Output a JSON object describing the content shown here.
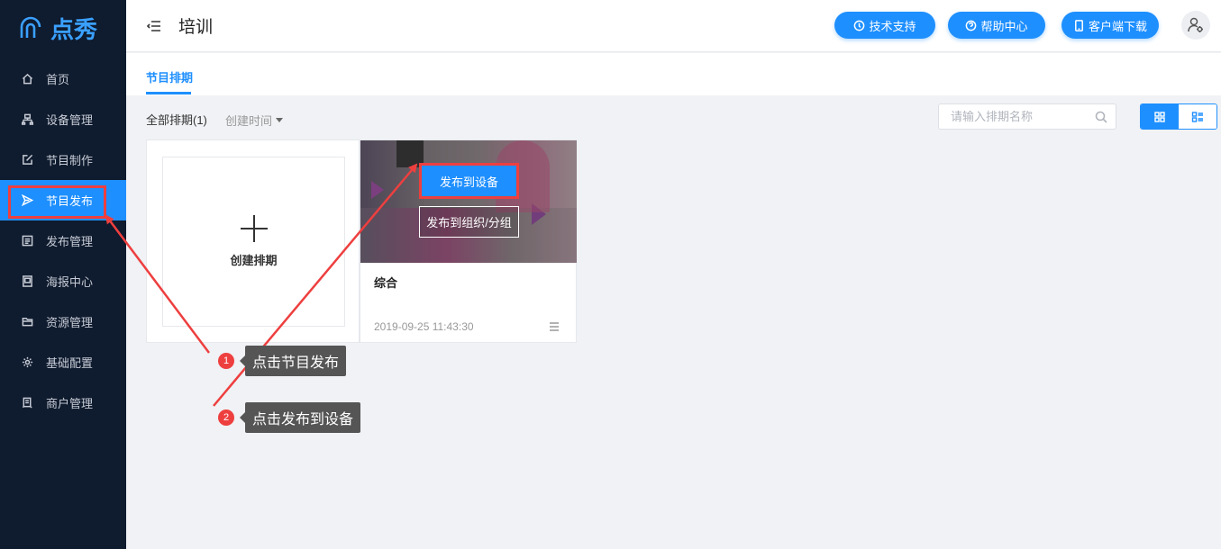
{
  "app": {
    "logo_text": "点秀",
    "brand_color": "#1e8fff"
  },
  "sidebar": {
    "items": [
      {
        "label": "首页",
        "icon": "home-icon"
      },
      {
        "label": "设备管理",
        "icon": "device-icon"
      },
      {
        "label": "节目制作",
        "icon": "edit-icon"
      },
      {
        "label": "节目发布",
        "icon": "send-icon",
        "active": true
      },
      {
        "label": "发布管理",
        "icon": "list-icon"
      },
      {
        "label": "海报中心",
        "icon": "poster-icon"
      },
      {
        "label": "资源管理",
        "icon": "folder-icon"
      },
      {
        "label": "基础配置",
        "icon": "gear-icon"
      },
      {
        "label": "商户管理",
        "icon": "merchant-icon"
      }
    ]
  },
  "header": {
    "title": "培训",
    "buttons": {
      "support": "技术支持",
      "help": "帮助中心",
      "download": "客户端下载"
    }
  },
  "tabs": {
    "active": "节目排期"
  },
  "filter": {
    "all_label": "全部排期(1)",
    "sort_label": "创建时间"
  },
  "search": {
    "placeholder": "请输入排期名称",
    "value": ""
  },
  "cards": {
    "create_label": "创建排期",
    "program": {
      "name": "综合",
      "date": "2019-09-25 11:43:30",
      "publish_device": "发布到设备",
      "publish_group": "发布到组织/分组"
    }
  },
  "annotations": {
    "step1_num": "1",
    "step1_text": "点击节目发布",
    "step2_num": "2",
    "step2_text": "点击发布到设备",
    "arrow_color": "#ee3f3f"
  }
}
